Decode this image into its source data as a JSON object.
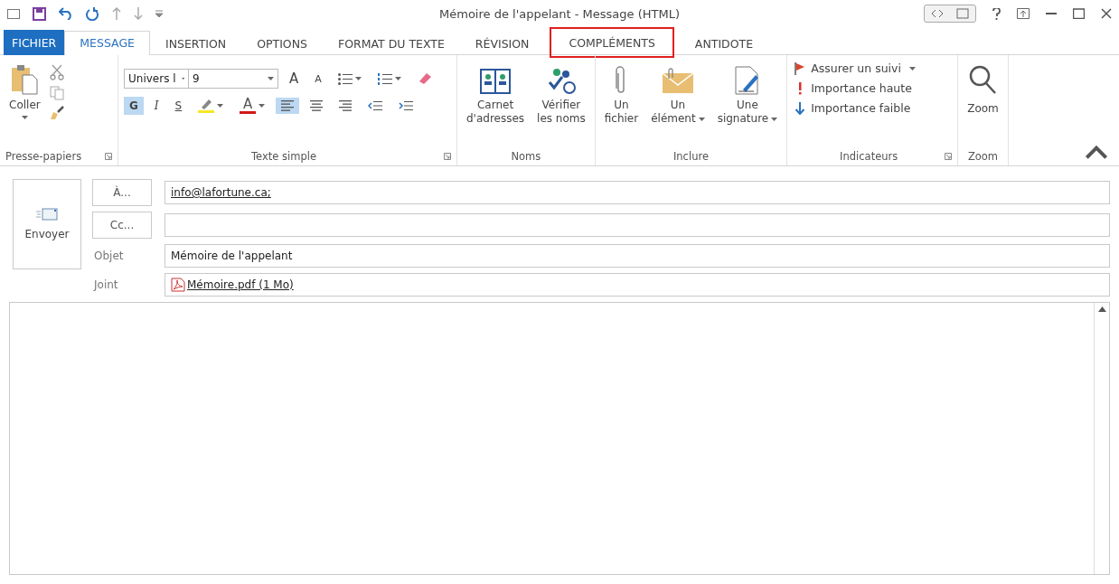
{
  "window": {
    "title": "Mémoire de l'appelant - Message (HTML)"
  },
  "tabs": [
    {
      "label": "FICHIER",
      "kind": "file",
      "selected": false,
      "highlighted": false
    },
    {
      "label": "MESSAGE",
      "kind": "tab",
      "selected": true,
      "highlighted": false
    },
    {
      "label": "INSERTION",
      "kind": "tab",
      "selected": false,
      "highlighted": false
    },
    {
      "label": "OPTIONS",
      "kind": "tab",
      "selected": false,
      "highlighted": false
    },
    {
      "label": "FORMAT DU TEXTE",
      "kind": "tab",
      "selected": false,
      "highlighted": false
    },
    {
      "label": "RÉVISION",
      "kind": "tab",
      "selected": false,
      "highlighted": false
    },
    {
      "label": "COMPLÉMENTS",
      "kind": "tab",
      "selected": false,
      "highlighted": true
    },
    {
      "label": "ANTIDOTE",
      "kind": "tab",
      "selected": false,
      "highlighted": false
    }
  ],
  "clipboard": {
    "paste": "Coller",
    "group_label": "Presse-papiers"
  },
  "text_format": {
    "font": "Univers l",
    "size": "9",
    "grow": "A",
    "shrink": "A",
    "font_color": "A",
    "styles": [
      {
        "label": "G",
        "kind": "bold",
        "selected": true
      },
      {
        "label": "I",
        "kind": "italic",
        "selected": false
      },
      {
        "label": "S",
        "kind": "underline",
        "selected": false
      }
    ],
    "align": [
      {
        "kind": "left",
        "selected": true
      },
      {
        "kind": "center",
        "selected": false
      },
      {
        "kind": "right",
        "selected": false
      }
    ],
    "group_label": "Texte simple"
  },
  "names": {
    "buttons": [
      {
        "label": "Carnet d'adresses",
        "kind": "book",
        "dropdown": false
      },
      {
        "label": "Vérifier les noms",
        "kind": "check",
        "dropdown": false
      }
    ],
    "group_label": "Noms"
  },
  "include": {
    "buttons": [
      {
        "label": "Un fichier",
        "kind": "clip",
        "dropdown": false
      },
      {
        "label": "Un élément",
        "kind": "envelope",
        "dropdown": true
      },
      {
        "label": "Une signature",
        "kind": "signature",
        "dropdown": true
      }
    ],
    "group_label": "Inclure"
  },
  "tags": {
    "items": [
      {
        "label": "Assurer un suivi",
        "kind": "flag",
        "dropdown": true
      },
      {
        "label": "Importance haute",
        "kind": "high",
        "dropdown": false
      },
      {
        "label": "Importance faible",
        "kind": "low",
        "dropdown": false
      }
    ],
    "group_label": "Indicateurs"
  },
  "zoom": {
    "button": "Zoom",
    "group_label": "Zoom"
  },
  "compose": {
    "send": "Envoyer",
    "to_button": "À...",
    "to_value": "info@lafortune.ca;",
    "cc_button": "Cc...",
    "subject_label": "Objet",
    "subject": "Mémoire de l'appelant",
    "attach_label": "Joint",
    "attachment": "Mémoire.pdf (1 Mo)"
  }
}
